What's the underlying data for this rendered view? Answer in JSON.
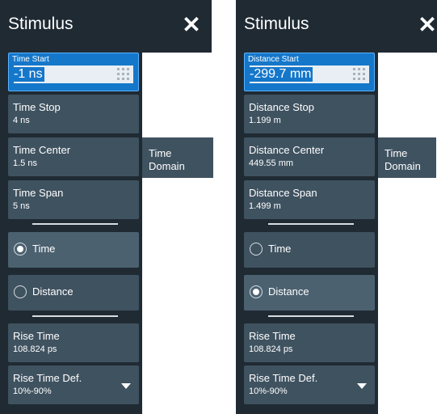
{
  "panels": [
    {
      "title": "Stimulus",
      "start": {
        "label": "Time Start",
        "value": "-1 ns"
      },
      "fields": [
        {
          "label": "Time Stop",
          "value": "4 ns"
        },
        {
          "label": "Time Center",
          "value": "1.5 ns"
        },
        {
          "label": "Time Span",
          "value": "5 ns"
        }
      ],
      "radio_time": "Time",
      "radio_distance": "Distance",
      "selected": "Time",
      "rise_time": {
        "label": "Rise Time",
        "value": "108.824 ps"
      },
      "rise_def": {
        "label": "Rise Time Def.",
        "value": "10%-90%"
      },
      "tab": "Time\nDomain"
    },
    {
      "title": "Stimulus",
      "start": {
        "label": "Distance Start",
        "value": "-299.7 mm"
      },
      "fields": [
        {
          "label": "Distance Stop",
          "value": "1.199 m"
        },
        {
          "label": "Distance Center",
          "value": "449.55 mm"
        },
        {
          "label": "Distance Span",
          "value": "1.499 m"
        }
      ],
      "radio_time": "Time",
      "radio_distance": "Distance",
      "selected": "Distance",
      "rise_time": {
        "label": "Rise Time",
        "value": "108.824 ps"
      },
      "rise_def": {
        "label": "Rise Time Def.",
        "value": "10%-90%"
      },
      "tab": "Time\nDomain"
    }
  ],
  "icons": {
    "close": "close-icon",
    "keypad": "keypad-icon",
    "dropdown": "chevron-down-icon"
  }
}
